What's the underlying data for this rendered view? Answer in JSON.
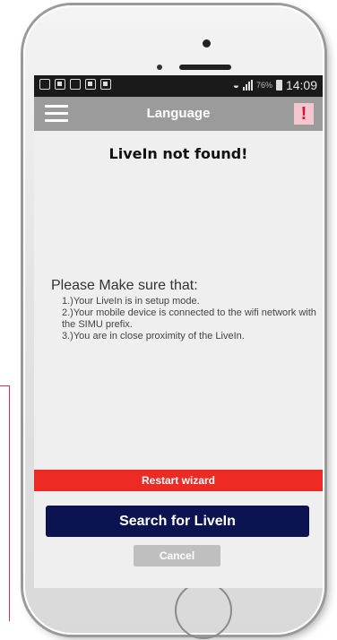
{
  "status_bar": {
    "battery_percent": "76%",
    "time": "14:09"
  },
  "header": {
    "title": "Language",
    "alert_label": "!"
  },
  "main": {
    "error_title": "LiveIn not found!",
    "instructions_heading": "Please Make sure that:",
    "instructions": [
      "1.)Your LiveIn is in setup mode.",
      "2.)Your mobile device is connected to the wifi network with the SIMU prefix.",
      "3.)You are in close proximity of the LiveIn."
    ]
  },
  "buttons": {
    "restart": "Restart wizard",
    "search": "Search for LiveIn",
    "cancel": "Cancel"
  },
  "colors": {
    "header_bg": "#9b9b9b",
    "restart_bg": "#ee2a24",
    "search_bg": "#0b1450",
    "cancel_bg": "#bfbfbf",
    "alert_fg": "#e0103a"
  }
}
